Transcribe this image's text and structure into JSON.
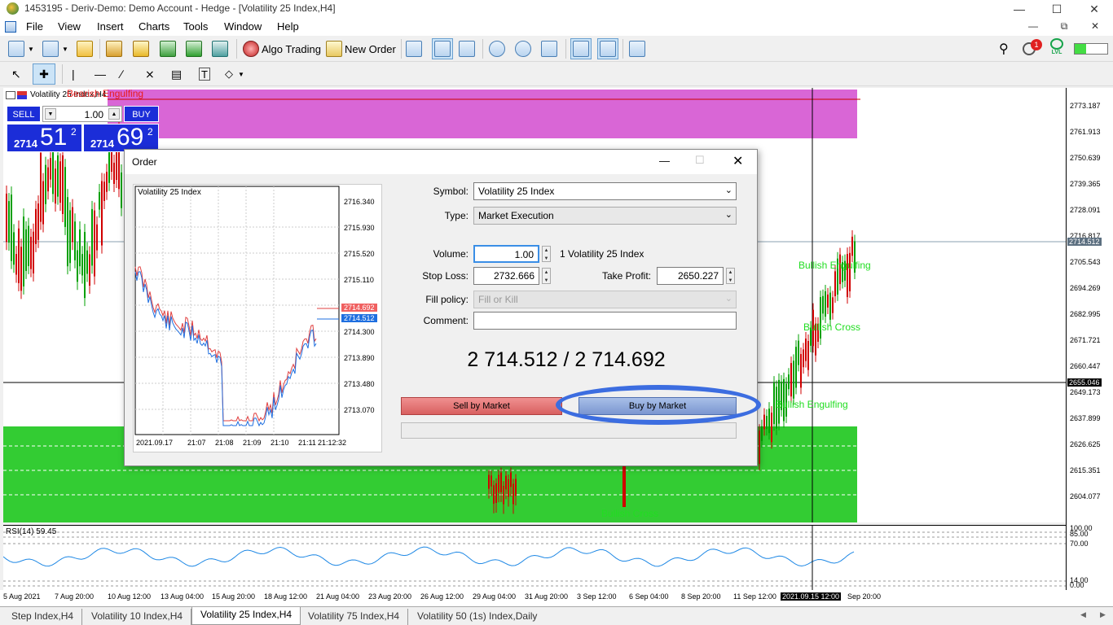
{
  "window": {
    "title": "1453195 - Deriv-Demo: Demo Account - Hedge - [Volatility 25 Index,H4]"
  },
  "menu": [
    "File",
    "View",
    "Insert",
    "Charts",
    "Tools",
    "Window",
    "Help"
  ],
  "toolbar": {
    "algo_trading": "Algo Trading",
    "new_order": "New Order",
    "notification_count": "1",
    "lvl_label": "LVL"
  },
  "oneclick": {
    "sell_label": "SELL",
    "buy_label": "BUY",
    "volume": "1.00",
    "sell_big": "2714",
    "sell_pips": "51",
    "sell_sup": "2",
    "buy_big": "2714",
    "buy_pips": "69",
    "buy_sup": "2"
  },
  "chart": {
    "title": "Volatility 25 Index,H4",
    "annotations": [
      "Bearish Engulfing",
      "Bullish Engulfing",
      "Bullish Cross",
      "Bullish Engulfing",
      "Bullish Cross"
    ],
    "price_labels": [
      "2773.187",
      "2761.913",
      "2750.639",
      "2739.365",
      "2728.091",
      "2716.817",
      "2714.512",
      "2705.543",
      "2694.269",
      "2682.995",
      "2671.721",
      "2660.447",
      "2655.046",
      "2649.173",
      "2637.899",
      "2626.625",
      "2615.351",
      "2604.077"
    ],
    "current_price": "2714.512",
    "crosshair_price": "2655.046",
    "rsi_label": "RSI(14) 59.45",
    "rsi_levels": [
      "100.00",
      "85.00",
      "70.00",
      "14.00",
      "0.00"
    ],
    "time_labels": [
      "5 Aug 2021",
      "7 Aug 20:00",
      "10 Aug 12:00",
      "13 Aug 04:00",
      "15 Aug 20:00",
      "18 Aug 12:00",
      "21 Aug 04:00",
      "23 Aug 20:00",
      "26 Aug 12:00",
      "29 Aug 04:00",
      "31 Aug 20:00",
      "3 Sep 12:00",
      "6 Sep 04:00",
      "8 Sep 20:00",
      "11 Sep 12:00",
      "2021.09.15 12:00",
      "Sep 20:00"
    ],
    "colors": {
      "bull": "#00a000",
      "bear": "#d00000",
      "supply_zone": "#d966d6",
      "demand_zone": "#33cc33"
    }
  },
  "order": {
    "title": "Order",
    "symbol_label": "Symbol:",
    "symbol_value": "Volatility 25 Index",
    "type_label": "Type:",
    "type_value": "Market Execution",
    "volume_label": "Volume:",
    "volume_value": "1.00",
    "volume_desc": "1 Volatility 25 Index",
    "sl_label": "Stop Loss:",
    "sl_value": "2732.666",
    "tp_label": "Take Profit:",
    "tp_value": "2650.227",
    "fill_label": "Fill policy:",
    "fill_value": "Fill or Kill",
    "comment_label": "Comment:",
    "comment_value": "",
    "quote": "2 714.512 / 2 714.692",
    "sell_button": "Sell by Market",
    "buy_button": "Buy by Market",
    "mini_title": "Volatility 25 Index",
    "mini_prices": [
      "2716.340",
      "2715.930",
      "2715.520",
      "2715.110",
      "2714.692",
      "2714.512",
      "2714.300",
      "2713.890",
      "2713.480",
      "2713.070"
    ],
    "mini_times": [
      "2021.09.17",
      "21:07",
      "21:08",
      "21:09",
      "21:10",
      "21:11",
      "21:12:32"
    ],
    "ask": "2714.692",
    "bid": "2714.512"
  },
  "tabs": [
    "Step Index,H4",
    "Volatility 10 Index,H4",
    "Volatility 25 Index,H4",
    "Volatility 75 Index,H4",
    "Volatility 50 (1s) Index,Daily"
  ],
  "active_tab": 2
}
